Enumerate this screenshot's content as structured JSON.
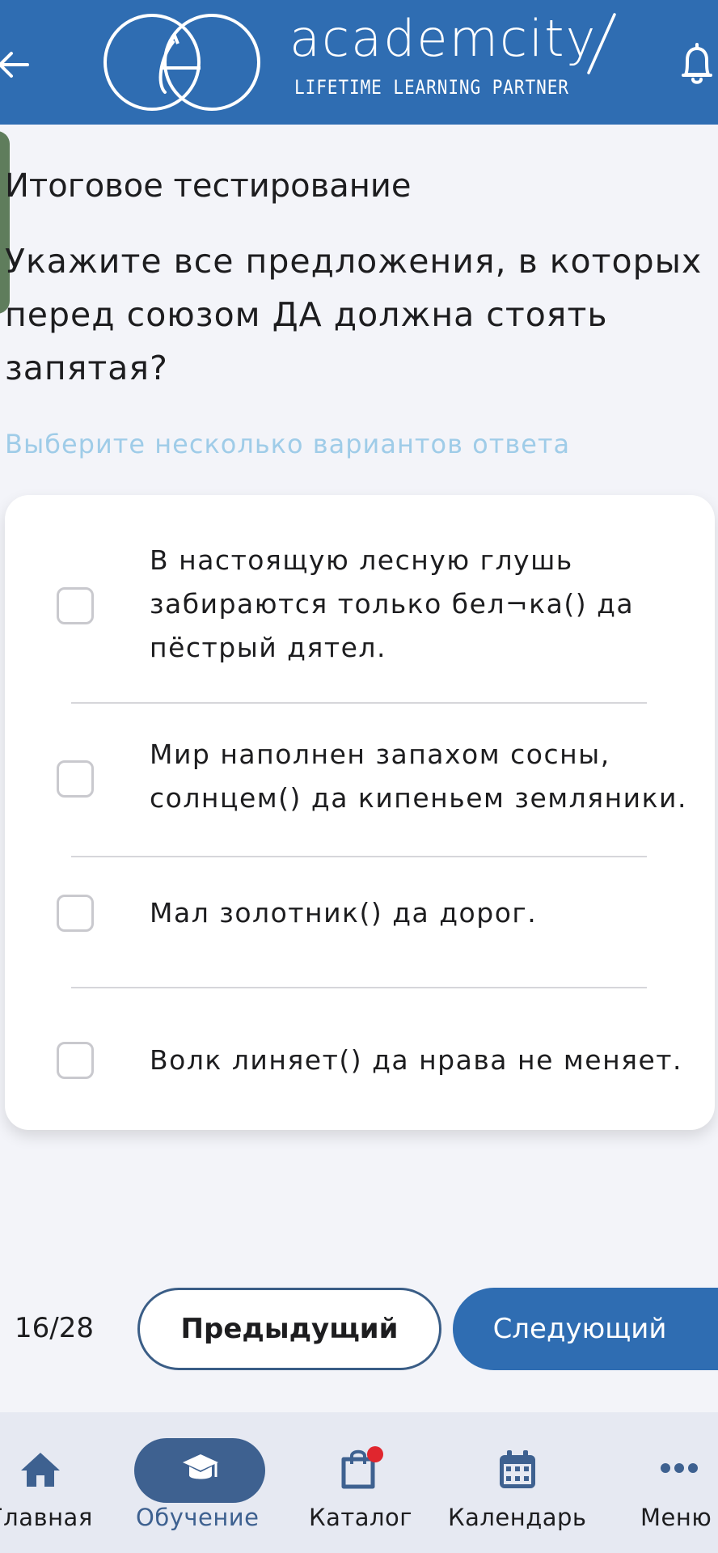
{
  "header": {
    "brand_name": "academcity",
    "tagline": "LIFETIME LEARNING PARTNER",
    "back_icon": "arrow-left-icon",
    "bell_icon": "bell-icon",
    "background_color": "#2f6db2"
  },
  "test": {
    "title": "Итоговое тестирование",
    "question": "Укажите все предложения, в которых перед союзом ДА должна стоять запятая?",
    "hint": "Выберите несколько вариантов ответа",
    "options": [
      {
        "text": "В настоящую лесную глушь забираются только бел¬ка() да пёстрый дятел.",
        "checked": false
      },
      {
        "text": "Мир наполнен запахом сосны, солнцем() да кипеньем земляники.",
        "checked": false
      },
      {
        "text": "Мал золотник() да дорог.",
        "checked": false
      },
      {
        "text": "Волк линяет() да нрава не меняет.",
        "checked": false
      }
    ]
  },
  "pagination": {
    "counter": "16/28",
    "prev_label": "Предыдущий",
    "next_label": "Следующий"
  },
  "bottom_nav": {
    "items": [
      {
        "label": "Главная",
        "icon": "home-icon",
        "active": false
      },
      {
        "label": "Обучение",
        "icon": "graduation-cap-icon",
        "active": true
      },
      {
        "label": "Каталог",
        "icon": "shopping-bag-icon",
        "active": false,
        "badge": true
      },
      {
        "label": "Календарь",
        "icon": "calendar-icon",
        "active": false
      },
      {
        "label": "Меню",
        "icon": "more-dots-icon",
        "active": false
      }
    ],
    "active_color": "#3e6190"
  }
}
